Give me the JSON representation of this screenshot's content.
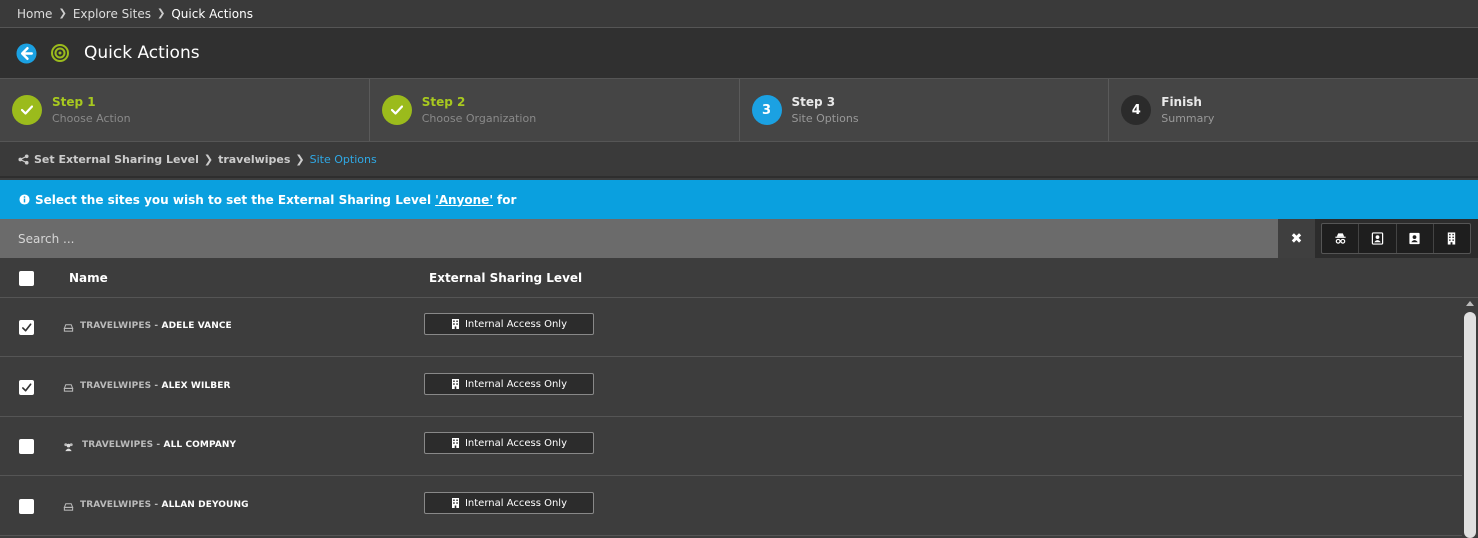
{
  "breadcrumb": {
    "items": [
      "Home",
      "Explore Sites",
      "Quick Actions"
    ]
  },
  "header": {
    "title": "Quick Actions"
  },
  "steps": [
    {
      "title": "Step 1",
      "subtitle": "Choose Action",
      "state": "done",
      "marker": ""
    },
    {
      "title": "Step 2",
      "subtitle": "Choose Organization",
      "state": "done",
      "marker": ""
    },
    {
      "title": "Step 3",
      "subtitle": "Site Options",
      "state": "active",
      "marker": "3"
    },
    {
      "title": "Finish",
      "subtitle": "Summary",
      "state": "pending",
      "marker": "4"
    }
  ],
  "sub_breadcrumb": {
    "items": [
      "Set External Sharing Level",
      "travelwipes",
      "Site Options"
    ]
  },
  "banner": {
    "prefix": "Select the sites you wish to set the External Sharing Level",
    "level": "'Anyone'",
    "suffix": "for"
  },
  "search": {
    "placeholder": "Search ..."
  },
  "table": {
    "columns": {
      "name": "Name",
      "level": "External Sharing Level"
    },
    "rows": [
      {
        "org": "TRAVELWIPES",
        "owner": "ADELE VANCE",
        "level": "Internal Access Only",
        "checked": true,
        "icon": "site-icon"
      },
      {
        "org": "TRAVELWIPES",
        "owner": "ALEX WILBER",
        "level": "Internal Access Only",
        "checked": true,
        "icon": "site-icon"
      },
      {
        "org": "TRAVELWIPES",
        "owner": "ALL COMPANY",
        "level": "Internal Access Only",
        "checked": false,
        "icon": "group-icon"
      },
      {
        "org": "TRAVELWIPES",
        "owner": "ALLAN DEYOUNG",
        "level": "Internal Access Only",
        "checked": false,
        "icon": "site-icon"
      }
    ]
  },
  "colors": {
    "accent_green": "#9bbb1c",
    "accent_blue": "#1ba1e2",
    "banner_blue": "#0aa0df"
  }
}
